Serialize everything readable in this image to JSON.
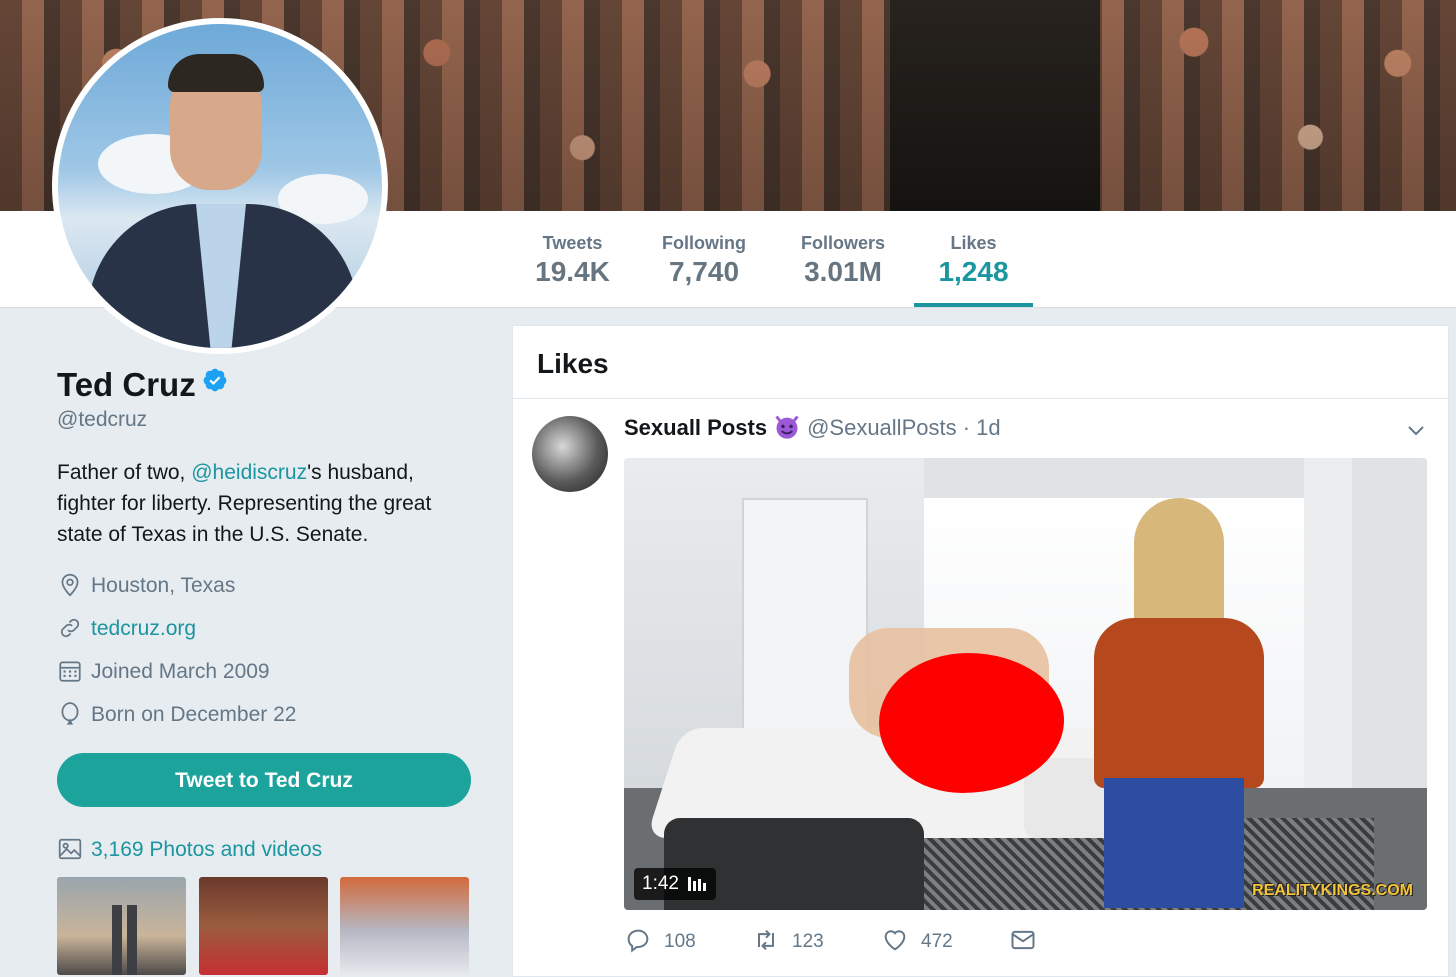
{
  "nav": {
    "stats": [
      {
        "label": "Tweets",
        "value": "19.4K"
      },
      {
        "label": "Following",
        "value": "7,740"
      },
      {
        "label": "Followers",
        "value": "3.01M"
      },
      {
        "label": "Likes",
        "value": "1,248"
      }
    ]
  },
  "profile": {
    "name": "Ted Cruz",
    "handle": "@tedcruz",
    "bio_before": "Father of two, ",
    "bio_mention": "@heidiscruz",
    "bio_after": "'s husband, fighter for liberty. Representing the great state of Texas in the U.S. Senate.",
    "location": "Houston, Texas",
    "website": "tedcruz.org",
    "joined": "Joined March 2009",
    "birthday": "Born on December 22",
    "tweet_button": "Tweet to Ted Cruz",
    "photos_link": "3,169 Photos and videos"
  },
  "likes_panel": {
    "title": "Likes",
    "tweet": {
      "name": "Sexuall Posts",
      "handle_time": "@SexuallPosts · 1d",
      "video_duration": "1:42",
      "watermark": "REALITYKINGS.COM",
      "replies": "108",
      "retweets": "123",
      "likes": "472"
    }
  },
  "colors": {
    "accent": "#1b95a0",
    "button": "#1ba39c",
    "censor": "#ff0000"
  }
}
